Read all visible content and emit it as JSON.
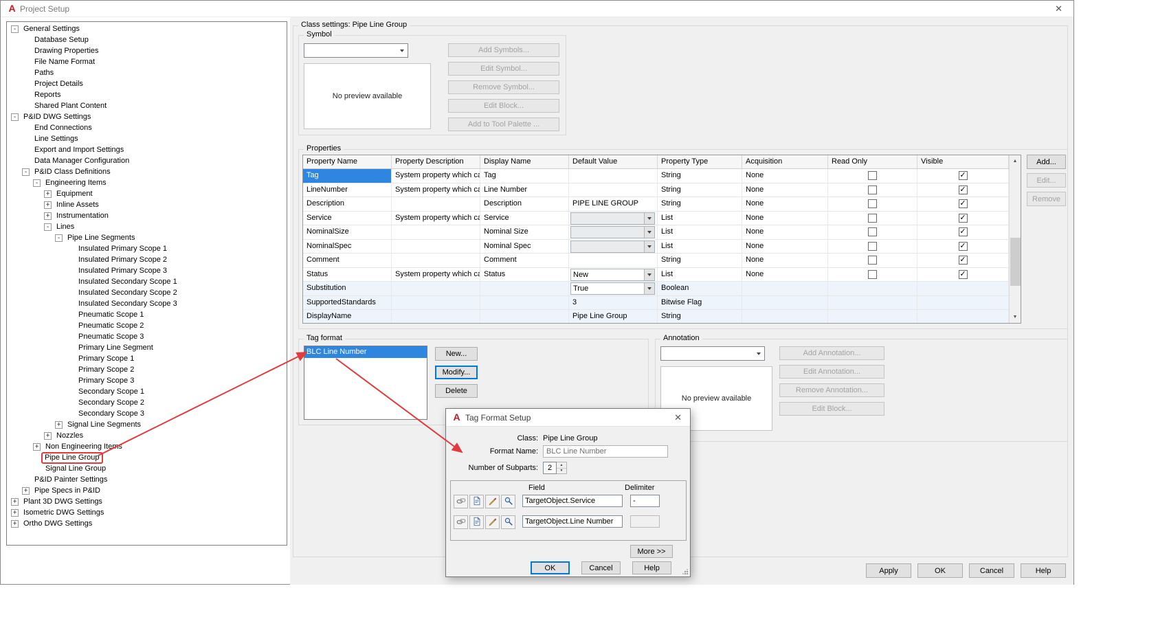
{
  "colors": {
    "selection": "#2e86e0",
    "annotation_red": "#e23b3b",
    "window_bg": "#f0f0f0"
  },
  "window": {
    "title": "Project Setup",
    "close_glyph": "✕"
  },
  "tree": {
    "items": [
      {
        "label": "General Settings",
        "level": 0,
        "glyph": "minus"
      },
      {
        "label": "Database Setup",
        "level": 1,
        "glyph": "none"
      },
      {
        "label": "Drawing Properties",
        "level": 1,
        "glyph": "none"
      },
      {
        "label": "File Name Format",
        "level": 1,
        "glyph": "none"
      },
      {
        "label": "Paths",
        "level": 1,
        "glyph": "none"
      },
      {
        "label": "Project Details",
        "level": 1,
        "glyph": "none"
      },
      {
        "label": "Reports",
        "level": 1,
        "glyph": "none"
      },
      {
        "label": "Shared Plant Content",
        "level": 1,
        "glyph": "none"
      },
      {
        "label": "P&ID DWG Settings",
        "level": 0,
        "glyph": "minus"
      },
      {
        "label": "End Connections",
        "level": 1,
        "glyph": "none"
      },
      {
        "label": "Line Settings",
        "level": 1,
        "glyph": "none"
      },
      {
        "label": "Export and Import Settings",
        "level": 1,
        "glyph": "none"
      },
      {
        "label": "Data Manager Configuration",
        "level": 1,
        "glyph": "none"
      },
      {
        "label": "P&ID Class Definitions",
        "level": 1,
        "glyph": "minus"
      },
      {
        "label": "Engineering Items",
        "level": 2,
        "glyph": "minus"
      },
      {
        "label": "Equipment",
        "level": 3,
        "glyph": "plus"
      },
      {
        "label": "Inline Assets",
        "level": 3,
        "glyph": "plus"
      },
      {
        "label": "Instrumentation",
        "level": 3,
        "glyph": "plus"
      },
      {
        "label": "Lines",
        "level": 3,
        "glyph": "minus"
      },
      {
        "label": "Pipe Line Segments",
        "level": 4,
        "glyph": "minus"
      },
      {
        "label": "Insulated Primary Scope 1",
        "level": 5,
        "glyph": "none"
      },
      {
        "label": "Insulated Primary Scope 2",
        "level": 5,
        "glyph": "none"
      },
      {
        "label": "Insulated Primary Scope 3",
        "level": 5,
        "glyph": "none"
      },
      {
        "label": "Insulated Secondary Scope 1",
        "level": 5,
        "glyph": "none"
      },
      {
        "label": "Insulated Secondary Scope 2",
        "level": 5,
        "glyph": "none"
      },
      {
        "label": "Insulated Secondary Scope 3",
        "level": 5,
        "glyph": "none"
      },
      {
        "label": "Pneumatic Scope 1",
        "level": 5,
        "glyph": "none"
      },
      {
        "label": "Pneumatic Scope 2",
        "level": 5,
        "glyph": "none"
      },
      {
        "label": "Pneumatic Scope 3",
        "level": 5,
        "glyph": "none"
      },
      {
        "label": "Primary Line Segment",
        "level": 5,
        "glyph": "none"
      },
      {
        "label": "Primary Scope 1",
        "level": 5,
        "glyph": "none"
      },
      {
        "label": "Primary Scope 2",
        "level": 5,
        "glyph": "none"
      },
      {
        "label": "Primary Scope 3",
        "level": 5,
        "glyph": "none"
      },
      {
        "label": "Secondary Scope 1",
        "level": 5,
        "glyph": "none"
      },
      {
        "label": "Secondary Scope 2",
        "level": 5,
        "glyph": "none"
      },
      {
        "label": "Secondary Scope 3",
        "level": 5,
        "glyph": "none"
      },
      {
        "label": "Signal Line Segments",
        "level": 4,
        "glyph": "plus"
      },
      {
        "label": "Nozzles",
        "level": 3,
        "glyph": "plus"
      },
      {
        "label": "Non Engineering Items",
        "level": 2,
        "glyph": "plus"
      },
      {
        "label": "Pipe Line Group",
        "level": 2,
        "glyph": "none",
        "boxed": true
      },
      {
        "label": "Signal Line Group",
        "level": 2,
        "glyph": "none"
      },
      {
        "label": "P&ID Painter Settings",
        "level": 1,
        "glyph": "none"
      },
      {
        "label": "Pipe Specs in P&ID",
        "level": 1,
        "glyph": "plus"
      },
      {
        "label": "Plant 3D DWG Settings",
        "level": 0,
        "glyph": "plus"
      },
      {
        "label": "Isometric DWG Settings",
        "level": 0,
        "glyph": "plus"
      },
      {
        "label": "Ortho DWG Settings",
        "level": 0,
        "glyph": "plus"
      }
    ]
  },
  "class_settings": {
    "heading": "Class settings: Pipe Line Group",
    "symbol": {
      "group_label": "Symbol",
      "dropdown_value": "",
      "preview_text": "No preview available",
      "buttons": [
        "Add Symbols...",
        "Edit Symbol...",
        "Remove Symbol...",
        "Edit Block...",
        "Add to Tool Palette ..."
      ]
    },
    "properties": {
      "group_label": "Properties",
      "columns": [
        "Property Name",
        "Property Description",
        "Display Name",
        "Default Value",
        "Property Type",
        "Acquisition",
        "Read Only",
        "Visible"
      ],
      "rows": [
        {
          "name": "Tag",
          "selected": true,
          "desc": "System property which ca...",
          "display": "Tag",
          "default": {
            "kind": "empty",
            "value": ""
          },
          "ptype": "String",
          "acq": "None",
          "read_only": "unchecked",
          "visible": "checked",
          "tint": false
        },
        {
          "name": "LineNumber",
          "selected": false,
          "desc": "System property which ca...",
          "display": "Line Number",
          "default": {
            "kind": "empty",
            "value": ""
          },
          "ptype": "String",
          "acq": "None",
          "read_only": "unchecked",
          "visible": "checked",
          "tint": false
        },
        {
          "name": "Description",
          "selected": false,
          "desc": "",
          "display": "Description",
          "default": {
            "kind": "text",
            "value": "PIPE LINE GROUP"
          },
          "ptype": "String",
          "acq": "None",
          "read_only": "unchecked",
          "visible": "checked",
          "tint": false
        },
        {
          "name": "Service",
          "selected": false,
          "desc": "System property which ca...",
          "display": "Service",
          "default": {
            "kind": "combo_disabled",
            "value": ""
          },
          "ptype": "List",
          "acq": "None",
          "read_only": "unchecked",
          "visible": "checked",
          "tint": false
        },
        {
          "name": "NominalSize",
          "selected": false,
          "desc": "",
          "display": "Nominal Size",
          "default": {
            "kind": "combo_disabled",
            "value": ""
          },
          "ptype": "List",
          "acq": "None",
          "read_only": "unchecked",
          "visible": "checked",
          "tint": false
        },
        {
          "name": "NominalSpec",
          "selected": false,
          "desc": "",
          "display": "Nominal Spec",
          "default": {
            "kind": "combo_disabled",
            "value": ""
          },
          "ptype": "List",
          "acq": "None",
          "read_only": "unchecked",
          "visible": "checked",
          "tint": false
        },
        {
          "name": "Comment",
          "selected": false,
          "desc": "",
          "display": "Comment",
          "default": {
            "kind": "empty",
            "value": ""
          },
          "ptype": "String",
          "acq": "None",
          "read_only": "unchecked",
          "visible": "checked",
          "tint": false
        },
        {
          "name": "Status",
          "selected": false,
          "desc": "System property which ca...",
          "display": "Status",
          "default": {
            "kind": "combo",
            "value": "New"
          },
          "ptype": "List",
          "acq": "None",
          "read_only": "unchecked",
          "visible": "checked",
          "tint": false
        },
        {
          "name": "Substitution",
          "selected": false,
          "desc": "",
          "display": "",
          "default": {
            "kind": "combo",
            "value": "True"
          },
          "ptype": "Boolean",
          "acq": "",
          "read_only": "none",
          "visible": "none",
          "tint": true
        },
        {
          "name": "SupportedStandards",
          "selected": false,
          "desc": "",
          "display": "",
          "default": {
            "kind": "text",
            "value": "3"
          },
          "ptype": "Bitwise Flag",
          "acq": "",
          "read_only": "none",
          "visible": "none",
          "tint": true
        },
        {
          "name": "DisplayName",
          "selected": false,
          "desc": "",
          "display": "",
          "default": {
            "kind": "text",
            "value": "Pipe Line Group"
          },
          "ptype": "String",
          "acq": "",
          "read_only": "none",
          "visible": "none",
          "tint": true
        }
      ],
      "side_buttons": [
        {
          "label": "Add...",
          "enabled": true
        },
        {
          "label": "Edit...",
          "enabled": false
        },
        {
          "label": "Remove",
          "enabled": false
        }
      ]
    },
    "tag_format": {
      "group_label": "Tag format",
      "items": [
        {
          "label": "BLC Line Number",
          "selected": true
        }
      ],
      "buttons": [
        {
          "label": "New...",
          "enabled": true,
          "focused": false
        },
        {
          "label": "Modify...",
          "enabled": true,
          "focused": true
        },
        {
          "label": "Delete",
          "enabled": true,
          "focused": false
        }
      ]
    },
    "annotation": {
      "group_label": "Annotation",
      "dropdown_value": "",
      "preview_text": "No preview available",
      "buttons": [
        "Add Annotation...",
        "Edit Annotation...",
        "Remove Annotation...",
        "Edit Block..."
      ]
    }
  },
  "footer": {
    "buttons": [
      "Apply",
      "OK",
      "Cancel",
      "Help"
    ]
  },
  "tag_dialog": {
    "title": "Tag Format Setup",
    "close_glyph": "✕",
    "class_label": "Class:",
    "class_value": "Pipe Line Group",
    "format_name_label": "Format Name:",
    "format_name_value": "BLC Line Number",
    "subparts_label": "Number of Subparts:",
    "subparts_value": "2",
    "field_header": "Field",
    "delimiter_header": "Delimiter",
    "row_icons": [
      "chain-icon",
      "document-icon",
      "pencil-icon",
      "magnifier-icon"
    ],
    "rows": [
      {
        "field": "TargetObject.Service",
        "delimiter": "-",
        "delimiter_enabled": true
      },
      {
        "field": "TargetObject.Line Number",
        "delimiter": "",
        "delimiter_enabled": false
      }
    ],
    "more_label": "More >>",
    "buttons": [
      {
        "label": "OK",
        "default": true
      },
      {
        "label": "Cancel",
        "default": false
      },
      {
        "label": "Help",
        "default": false
      }
    ]
  }
}
